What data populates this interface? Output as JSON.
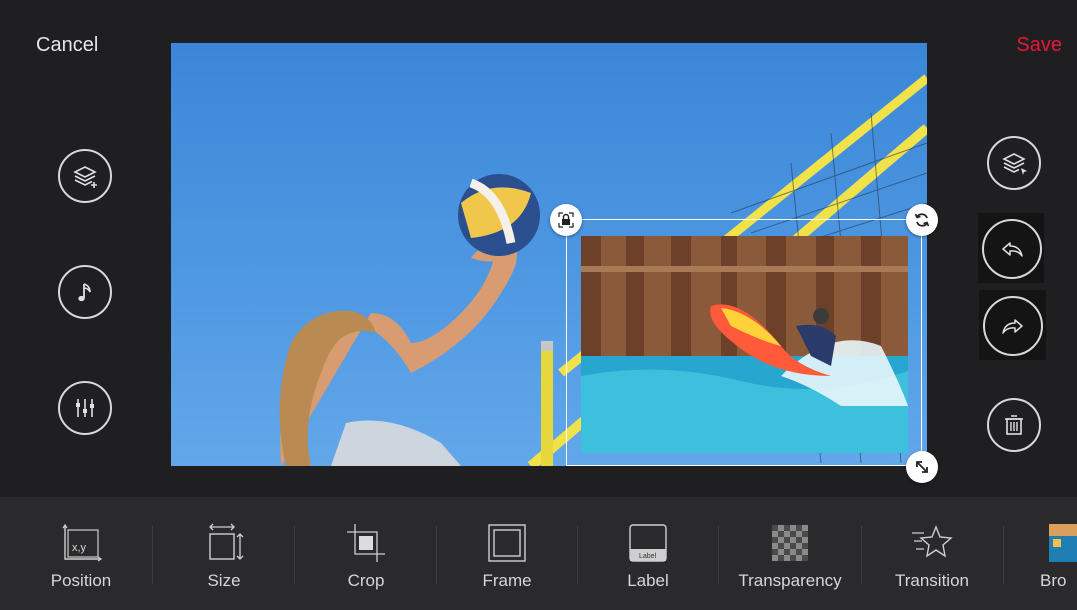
{
  "header": {
    "cancel_label": "Cancel",
    "save_label": "Save",
    "save_color": "#e8173a"
  },
  "left_tools": [
    {
      "icon": "add-layer-icon"
    },
    {
      "icon": "music-note-icon"
    },
    {
      "icon": "equalizer-icon"
    }
  ],
  "right_tools": [
    {
      "icon": "select-layer-icon"
    },
    {
      "icon": "undo-icon"
    },
    {
      "icon": "redo-icon"
    },
    {
      "icon": "trash-icon"
    }
  ],
  "overlay": {
    "handles": [
      "lock-icon",
      "rotate-icon",
      "resize-icon"
    ]
  },
  "toolbar": {
    "items": [
      {
        "label": "Position",
        "icon": "position-icon",
        "icon_text": "x,y"
      },
      {
        "label": "Size",
        "icon": "size-icon"
      },
      {
        "label": "Crop",
        "icon": "crop-icon"
      },
      {
        "label": "Frame",
        "icon": "frame-icon"
      },
      {
        "label": "Label",
        "icon": "label-icon",
        "icon_text": "Label"
      },
      {
        "label": "Transparency",
        "icon": "transparency-icon"
      },
      {
        "label": "Transition",
        "icon": "transition-icon"
      },
      {
        "label": "Bro",
        "icon": "border-icon"
      }
    ]
  }
}
